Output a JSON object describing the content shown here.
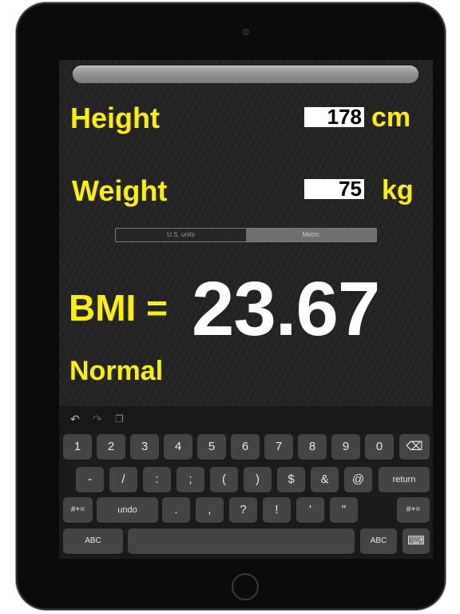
{
  "inputs": {
    "height_label": "Height",
    "height_value": "178",
    "height_unit": "cm",
    "weight_label": "Weight",
    "weight_value": "75",
    "weight_unit": "kg"
  },
  "units_toggle": {
    "us_label": "U.S. units",
    "metric_label": "Metric",
    "selected": "Metric"
  },
  "result": {
    "bmi_label": "BMI =",
    "bmi_value": "23.67",
    "category": "Normal"
  },
  "keyboard": {
    "toolbar": {
      "undo": "↶",
      "redo": "↷",
      "paste": "❐"
    },
    "row1": [
      "1",
      "2",
      "3",
      "4",
      "5",
      "6",
      "7",
      "8",
      "9",
      "0"
    ],
    "backspace": "⌫",
    "row2": [
      "-",
      "/",
      ":",
      ";",
      "(",
      ")",
      "$",
      "&",
      "@"
    ],
    "return_label": "return",
    "row3": {
      "shift_left": "#+=",
      "undo": "undo",
      "keys": [
        ".",
        ",",
        "?",
        "!",
        "'",
        "\""
      ],
      "shift_right": "#+="
    },
    "row4": {
      "abc_left": "ABC",
      "space": "",
      "abc_right": "ABC",
      "dismiss": "⌨"
    }
  },
  "colors": {
    "accent_yellow": "#fbf000",
    "screen_bg": "#232323",
    "key_bg": "#444444"
  }
}
